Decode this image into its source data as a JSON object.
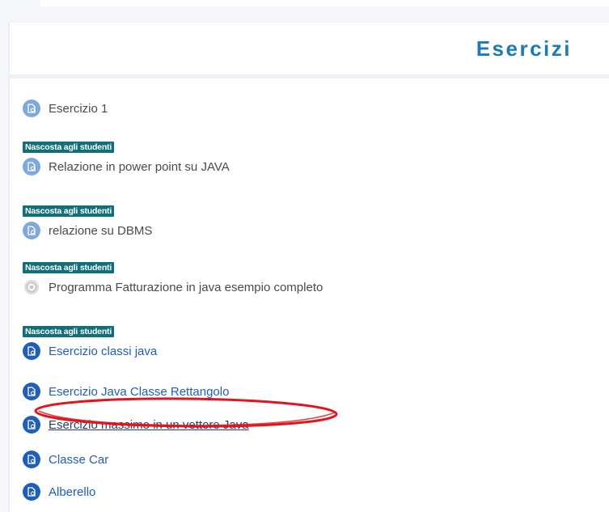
{
  "section": {
    "title": "Esercizi"
  },
  "hidden_badge": "Nascosta agli studenti",
  "activities": [
    {
      "label": "Esercizio 1",
      "icon": "assignment-icon",
      "hidden": false,
      "style": "dim"
    },
    {
      "label": "Relazione in power point su JAVA",
      "icon": "assignment-icon",
      "hidden": true,
      "style": "dim"
    },
    {
      "label": "relazione su DBMS",
      "icon": "assignment-icon",
      "hidden": true,
      "style": "dim"
    },
    {
      "label": "Programma Fatturazione in java esempio completo",
      "icon": "gear-icon",
      "hidden": true,
      "style": "dim"
    },
    {
      "label": "Esercizio classi java",
      "icon": "assignment-icon",
      "hidden": true,
      "style": "link"
    },
    {
      "label": "Esercizio Java Classe Rettangolo",
      "icon": "assignment-icon",
      "hidden": false,
      "style": "link"
    },
    {
      "label": "Esercizio massimo in un vettore Java",
      "icon": "assignment-icon",
      "hidden": false,
      "style": "underlined"
    },
    {
      "label": "Classe Car",
      "icon": "assignment-icon",
      "hidden": false,
      "style": "link"
    },
    {
      "label": "Alberello",
      "icon": "assignment-icon",
      "hidden": false,
      "style": "link"
    }
  ],
  "colors": {
    "title": "#1a7bb8",
    "badge_bg": "#0f6f7a",
    "link": "#1f5fb8",
    "icon_light": "#7fa9dc",
    "annotation": "#e0161c"
  }
}
